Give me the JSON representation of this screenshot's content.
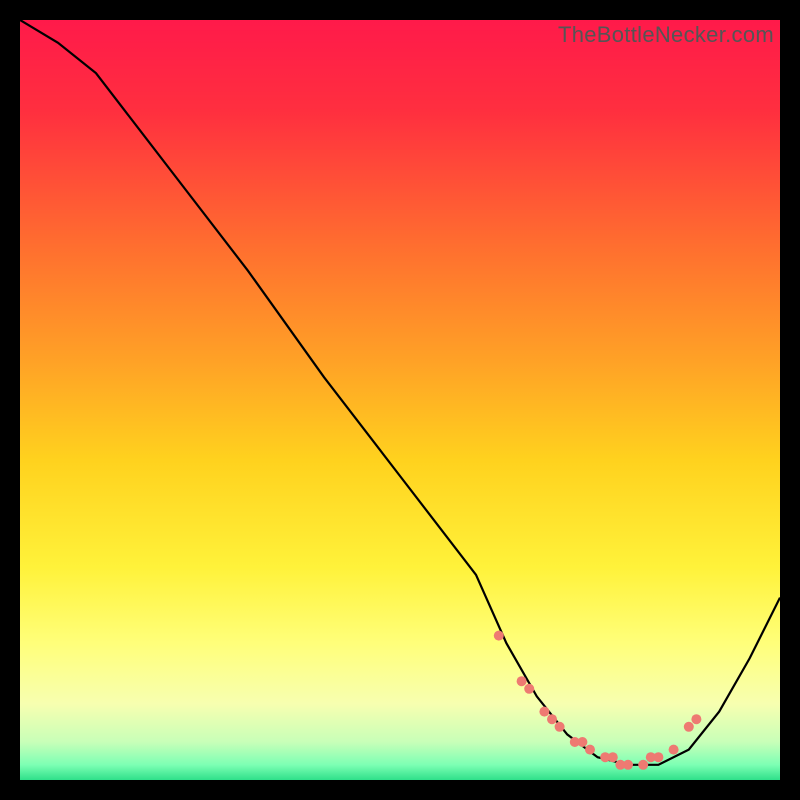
{
  "watermark": "TheBottleNecker.com",
  "gradient": {
    "stops": [
      {
        "offset": "0%",
        "color": "#ff1a4a"
      },
      {
        "offset": "12%",
        "color": "#ff2f3f"
      },
      {
        "offset": "30%",
        "color": "#ff6f2f"
      },
      {
        "offset": "45%",
        "color": "#ffa226"
      },
      {
        "offset": "58%",
        "color": "#ffd21e"
      },
      {
        "offset": "72%",
        "color": "#fff23a"
      },
      {
        "offset": "82%",
        "color": "#ffff7a"
      },
      {
        "offset": "90%",
        "color": "#f7ffb0"
      },
      {
        "offset": "95%",
        "color": "#c8ffb8"
      },
      {
        "offset": "98%",
        "color": "#7dffb4"
      },
      {
        "offset": "100%",
        "color": "#2fe08a"
      }
    ]
  },
  "chart_data": {
    "type": "line",
    "title": "",
    "xlabel": "",
    "ylabel": "",
    "xlim": [
      0,
      100
    ],
    "ylim": [
      0,
      100
    ],
    "series": [
      {
        "name": "bottleneck-curve",
        "x": [
          0,
          5,
          10,
          20,
          30,
          40,
          50,
          60,
          64,
          68,
          72,
          76,
          80,
          84,
          88,
          92,
          96,
          100
        ],
        "y": [
          100,
          97,
          93,
          80,
          67,
          53,
          40,
          27,
          18,
          11,
          6,
          3,
          2,
          2,
          4,
          9,
          16,
          24
        ]
      }
    ],
    "highlight_points": {
      "name": "optimal-range-markers",
      "color": "#ee7a72",
      "radius": 5,
      "x": [
        63,
        66,
        67,
        69,
        70,
        71,
        73,
        74,
        75,
        77,
        78,
        79,
        80,
        82,
        83,
        84,
        86,
        88,
        89
      ],
      "y": [
        19,
        13,
        12,
        9,
        8,
        7,
        5,
        5,
        4,
        3,
        3,
        2,
        2,
        2,
        3,
        3,
        4,
        7,
        8
      ]
    }
  }
}
